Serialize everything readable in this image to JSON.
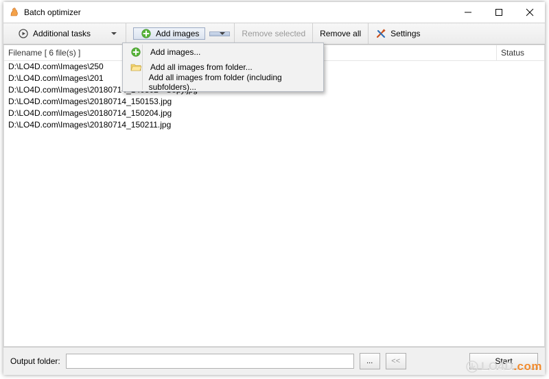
{
  "window": {
    "title": "Batch optimizer"
  },
  "toolbar": {
    "additional_tasks": "Additional tasks",
    "add_images": "Add images",
    "remove_selected": "Remove selected",
    "remove_all": "Remove all",
    "settings": "Settings"
  },
  "dropdown": {
    "items": [
      "Add images...",
      "Add all images from folder...",
      "Add all images from folder (including subfolders)..."
    ]
  },
  "columns": {
    "filename": "Filename [ 6 file(s) ]",
    "status": "Status"
  },
  "files": [
    "D:\\LO4D.com\\Images\\250",
    "D:\\LO4D.com\\Images\\201",
    "D:\\LO4D.com\\Images\\20180714_140302 - Copy.jpg",
    "D:\\LO4D.com\\Images\\20180714_150153.jpg",
    "D:\\LO4D.com\\Images\\20180714_150204.jpg",
    "D:\\LO4D.com\\Images\\20180714_150211.jpg"
  ],
  "footer": {
    "output_label": "Output folder:",
    "output_value": "",
    "browse": "...",
    "collapse": "<<",
    "start": "Start"
  },
  "watermark": {
    "prefix": "LO4D",
    "suffix": ".com"
  }
}
